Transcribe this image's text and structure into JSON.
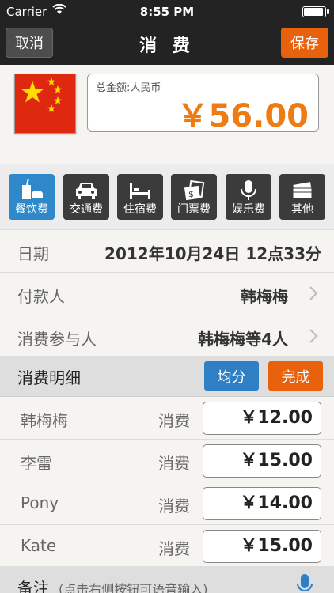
{
  "status": {
    "carrier": "Carrier",
    "time": "8:55 PM"
  },
  "nav": {
    "cancel": "取消",
    "title": "消 费",
    "save": "保存"
  },
  "amount": {
    "label": "总金额:人民币",
    "value": "￥56.00"
  },
  "categories": [
    {
      "label": "餐饮费",
      "icon": "food-drink-icon",
      "active": true
    },
    {
      "label": "交通费",
      "icon": "car-icon",
      "active": false
    },
    {
      "label": "住宿费",
      "icon": "bed-icon",
      "active": false
    },
    {
      "label": "门票费",
      "icon": "ticket-icon",
      "active": false
    },
    {
      "label": "娱乐费",
      "icon": "microphone-icon",
      "active": false
    },
    {
      "label": "其他",
      "icon": "money-icon",
      "active": false
    }
  ],
  "info": {
    "date_label": "日期",
    "date_value": "2012年10月24日 12点33分",
    "payer_label": "付款人",
    "payer_value": "韩梅梅",
    "participants_label": "消费参与人",
    "participants_value": "韩梅梅等4人"
  },
  "detail": {
    "title": "消费明细",
    "split": "均分",
    "done": "完成",
    "rows": [
      {
        "name": "韩梅梅",
        "kind": "消费",
        "amount": "￥12.00"
      },
      {
        "name": "李雷",
        "kind": "消费",
        "amount": "￥15.00"
      },
      {
        "name": "Pony",
        "kind": "消费",
        "amount": "￥14.00"
      },
      {
        "name": "Kate",
        "kind": "消费",
        "amount": "￥15.00"
      }
    ]
  },
  "notes": {
    "title": "备注",
    "hint": "(点击右侧按钮可语音输入)"
  },
  "colors": {
    "accent_orange": "#e8620e",
    "amount_orange": "#ef7c12",
    "blue": "#2f7fc4",
    "header": "#232323"
  }
}
